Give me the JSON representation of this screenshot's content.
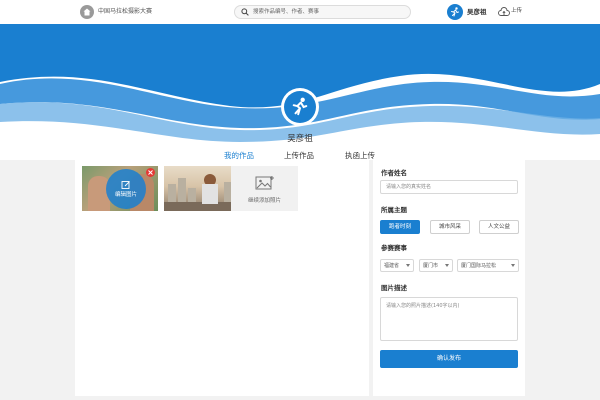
{
  "header": {
    "site_title": "中国马拉松摄影大赛",
    "search_placeholder": "搜索作品编号、作者、赛事",
    "username": "吴彦祖",
    "upload_label": "上传"
  },
  "profile": {
    "name": "吴彦祖",
    "tabs": [
      {
        "label": "我的作品",
        "active": true
      },
      {
        "label": "上传作品",
        "active": false
      },
      {
        "label": "执函上传",
        "active": false
      }
    ]
  },
  "gallery": {
    "edit_label": "编辑图片",
    "add_label": "继续添加照片"
  },
  "form": {
    "author_label": "作者姓名",
    "author_placeholder": "请输入您的真实姓名",
    "theme_label": "所属主题",
    "themes": [
      {
        "label": "跑者时刻",
        "active": true
      },
      {
        "label": "城市风采",
        "active": false
      },
      {
        "label": "人文公益",
        "active": false
      }
    ],
    "event_label": "参赛赛事",
    "event_selects": [
      "福建省",
      "厦门市",
      "厦门国际马拉松"
    ],
    "description_label": "图片描述",
    "description_placeholder": "请输入您的照片描述(140字以内)",
    "submit_label": "确认发布"
  },
  "colors": {
    "brand_blue": "#1a7fd0",
    "remove_red": "#e53935"
  },
  "icons": [
    "home-icon",
    "search-icon",
    "runner-icon",
    "cloud-upload-icon",
    "edit-icon",
    "close-icon",
    "image-add-icon"
  ]
}
